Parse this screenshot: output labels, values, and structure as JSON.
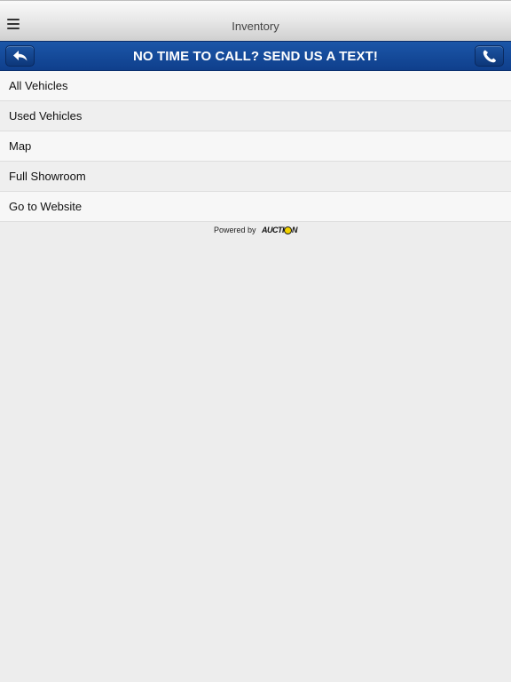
{
  "header": {
    "title": "Inventory",
    "menu_icon": "hamburger-menu-icon"
  },
  "bluebar": {
    "text": "NO TIME TO CALL? SEND US A TEXT!",
    "back_icon": "back-arrow-icon",
    "call_icon": "phone-icon",
    "accent_color": "#1a4f9e"
  },
  "menu": {
    "items": [
      {
        "label": "All Vehicles"
      },
      {
        "label": "Used Vehicles"
      },
      {
        "label": "Map"
      },
      {
        "label": "Full Showroom"
      },
      {
        "label": "Go to Website"
      }
    ]
  },
  "footer": {
    "powered_by": "Powered by",
    "logo_text_a": "AUCTI",
    "logo_text_b": "N",
    "logo_accent": "#f2d200"
  }
}
